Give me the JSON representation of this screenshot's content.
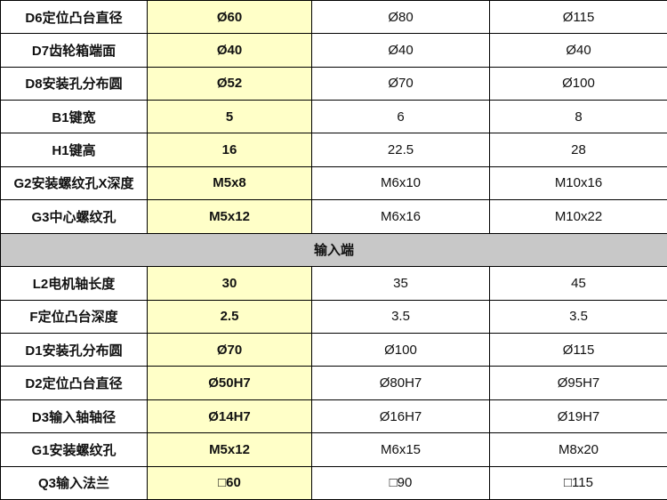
{
  "section_top": {
    "rows": [
      {
        "label": "D6定位凸台直径",
        "a": "Ø60",
        "b": "Ø80",
        "c": "Ø115"
      },
      {
        "label": "D7齿轮箱端面",
        "a": "Ø40",
        "b": "Ø40",
        "c": "Ø40"
      },
      {
        "label": "D8安装孔分布圆",
        "a": "Ø52",
        "b": "Ø70",
        "c": "Ø100"
      },
      {
        "label": "B1键宽",
        "a": "5",
        "b": "6",
        "c": "8"
      },
      {
        "label": "H1键高",
        "a": "16",
        "b": "22.5",
        "c": "28"
      },
      {
        "label": "G2安装螺纹孔X深度",
        "a": "M5x8",
        "b": "M6x10",
        "c": "M10x16"
      },
      {
        "label": "G3中心螺纹孔",
        "a": "M5x12",
        "b": "M6x16",
        "c": "M10x22"
      }
    ]
  },
  "section_input": {
    "title": "输入端",
    "rows": [
      {
        "label": "L2电机轴长度",
        "a": "30",
        "b": "35",
        "c": "45"
      },
      {
        "label": "F定位凸台深度",
        "a": "2.5",
        "b": "3.5",
        "c": "3.5"
      },
      {
        "label": "D1安装孔分布圆",
        "a": "Ø70",
        "b": "Ø100",
        "c": "Ø115"
      },
      {
        "label": "D2定位凸台直径",
        "a": "Ø50H7",
        "b": "Ø80H7",
        "c": "Ø95H7"
      },
      {
        "label": "D3输入轴轴径",
        "a": "Ø14H7",
        "b": "Ø16H7",
        "c": "Ø19H7"
      },
      {
        "label": "G1安装螺纹孔",
        "a": "M5x12",
        "b": "M6x15",
        "c": "M8x20"
      },
      {
        "label": "Q3输入法兰",
        "a": "□60",
        "b": "□90",
        "c": "□115"
      }
    ]
  },
  "colors": {
    "highlight_column": "#ffffc8",
    "section_header": "#c8c8c8",
    "border": "#000000"
  }
}
